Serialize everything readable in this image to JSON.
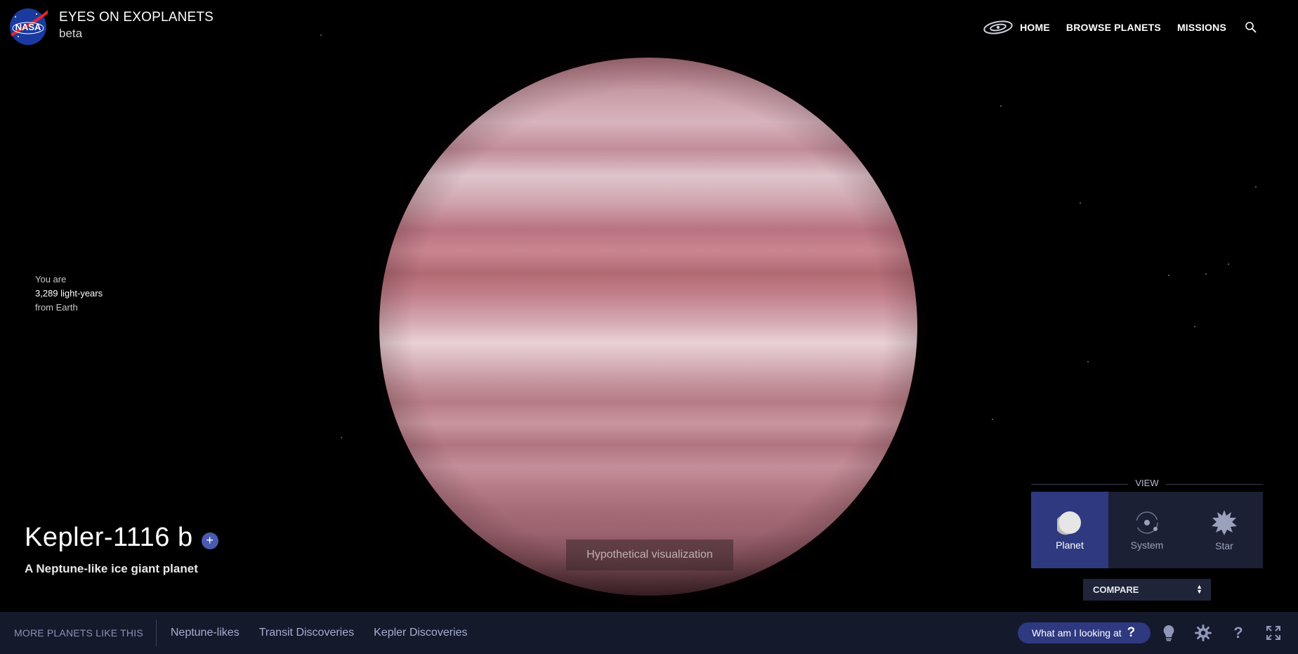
{
  "header": {
    "logo_text": "NASA",
    "title": "EYES ON EXOPLANETS",
    "subtitle": "beta",
    "nav": [
      "HOME",
      "BROWSE PLANETS",
      "MISSIONS"
    ]
  },
  "distance": {
    "line1": "You are",
    "value": "3,289 light-years",
    "line3": "from Earth"
  },
  "planet": {
    "name": "Kepler-1116 b",
    "add_label": "+",
    "description": "A Neptune-like ice giant planet",
    "caption": "Hypothetical visualization"
  },
  "view_panel": {
    "label": "VIEW",
    "options": [
      "Planet",
      "System",
      "Star"
    ],
    "active": "Planet",
    "compare_label": "COMPARE"
  },
  "bottom_bar": {
    "more_label": "MORE PLANETS LIKE THIS",
    "links": [
      "Neptune-likes",
      "Transit Discoveries",
      "Kepler Discoveries"
    ],
    "help_label": "What am I looking at",
    "help_icon": "?"
  },
  "colors": {
    "accent": "#2e3980",
    "panel": "#1c2035",
    "bar": "#14192b"
  }
}
